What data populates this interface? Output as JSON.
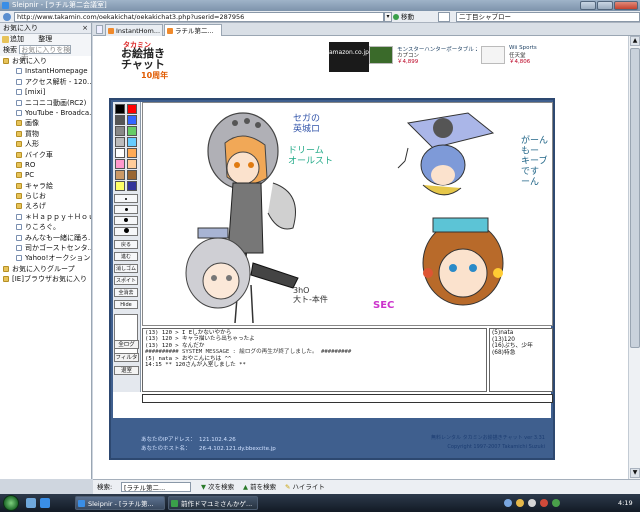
{
  "window": {
    "title": "Sleipnir - [ラチル第二会議室]"
  },
  "addressbar": {
    "url": "http://www.takamin.com/oekakichat/oekakichat3.php?userid=287956",
    "go_label": "移動",
    "search_value": "二丁目シャブロー"
  },
  "sidebar": {
    "title": "お気に入り",
    "add_label": "追加",
    "organize_label": "整理",
    "search_label": "検索",
    "search_placeholder": "お気に入りを検索",
    "items": [
      {
        "label": "お気に入り",
        "type": "folder",
        "level": 0
      },
      {
        "label": "InstantHomepage",
        "type": "page",
        "level": 1
      },
      {
        "label": "アクセス解析 - 120...",
        "type": "page",
        "level": 1
      },
      {
        "label": "[mixi]",
        "type": "page",
        "level": 1
      },
      {
        "label": "ニコニコ動画(RC2)",
        "type": "page",
        "level": 1
      },
      {
        "label": "YouTube - Broadca...",
        "type": "page",
        "level": 1
      },
      {
        "label": "画像",
        "type": "folder",
        "level": 1
      },
      {
        "label": "買物",
        "type": "folder",
        "level": 1
      },
      {
        "label": "人形",
        "type": "folder",
        "level": 1
      },
      {
        "label": "バイク車",
        "type": "folder",
        "level": 1
      },
      {
        "label": "RO",
        "type": "folder",
        "level": 1
      },
      {
        "label": "PC",
        "type": "folder",
        "level": 1
      },
      {
        "label": "キャラ絵",
        "type": "folder",
        "level": 1
      },
      {
        "label": "らじお",
        "type": "folder",
        "level": 1
      },
      {
        "label": "えろげ",
        "type": "folder",
        "level": 1
      },
      {
        "label": "＊Ｈａｐｐｙ＋Ｈｏｕ...",
        "type": "page",
        "level": 1
      },
      {
        "label": "りころぐ。",
        "type": "page",
        "level": 1
      },
      {
        "label": "みんなも一緒に踊ろ...",
        "type": "page",
        "level": 1
      },
      {
        "label": "司かゴーストセンタ...",
        "type": "page",
        "level": 1
      },
      {
        "label": "Yahoo!オークション...",
        "type": "page",
        "level": 1
      },
      {
        "label": "お気に入りグループ",
        "type": "folder",
        "level": 0
      },
      {
        "label": "[IE]ブラウザお気に入り",
        "type": "folder",
        "level": 0
      }
    ]
  },
  "tabs": [
    {
      "label": "InstantHom...",
      "active": false
    },
    {
      "label": "ラチル第二...",
      "active": true
    }
  ],
  "page": {
    "logo": {
      "top": "タカミン",
      "main": "お絵描き\nチャット",
      "sub": "10周年"
    },
    "ads": {
      "amazon_label": "amazon.co.jp",
      "items": [
        {
          "title": "モンスターハンターポータブル 2nd G",
          "sub": "カプコン",
          "price": "￥4,899"
        },
        {
          "title": "Wii Sports",
          "sub": "任天堂",
          "price": "￥4,806"
        }
      ]
    },
    "canvas_texts": {
      "t1": "セガの\n英城ロ",
      "t2": "ドリーム\nオールスト",
      "t3": "がーん\nもー\nキーブ\nです\nーん",
      "t4": "3hO\n大ト-本件",
      "t5": "SEC"
    },
    "toolbar_buttons": [
      "戻る",
      "進む",
      "消しゴム",
      "スポイト",
      "全消去",
      "Hide"
    ],
    "chat_lines": [
      "(13) 120 > I Eしかないやから",
      "(13) 120 > キャラ描いたら出ちゃったよ",
      "(13) 120 > なんだか",
      "########## SYSTEM MESSAGE : 絵ログの再生が終了しました。 #########",
      "(5) nata > おやこんにちは ^^",
      "14:15 ** 120さんが入室しました **"
    ],
    "users": [
      "(5)nata",
      "(13)120",
      "(16)ぷち、少年",
      "(68)特急"
    ],
    "side_buttons": [
      "全ログ",
      "フィルタ",
      "退室"
    ],
    "info": {
      "ip_label": "あなたのIPアドレス：",
      "ip_value": "121.102.4.26",
      "host_label": "あなたのホスト名：",
      "host_value": "26-4.102.121.dy.bbexcite.jp"
    },
    "credit": {
      "line1": "無料レンタル タカミンお絵描きチャット ver 3.31",
      "line2": "Copyright 1997-2007 Takamichi Suzuki"
    }
  },
  "findbar": {
    "label": "検索:",
    "value": "[ラチル第二...",
    "next_label": "次を検索",
    "prev_label": "前を検索",
    "highlight_label": "ハイライト"
  },
  "taskbar": {
    "tasks": [
      "Sleipnir - [ラチル第...",
      "前作ドマユミさんかゲ..."
    ],
    "clock": "4:19"
  },
  "colors": {
    "frame_blue": "#3f5f8e",
    "credit_blue": "#1c3d72"
  }
}
